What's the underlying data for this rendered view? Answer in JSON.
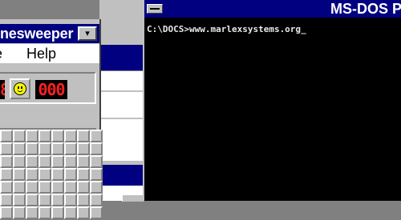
{
  "minesweeper": {
    "title": "nesweeper",
    "title_button_glyph": "▾",
    "menu": {
      "game_label": "e",
      "help_label": "Help"
    },
    "mine_counter": "8",
    "timer": "000",
    "face_icon": "smiley-face-icon",
    "grid": {
      "columns": 8,
      "visible_rows": 7
    }
  },
  "dos": {
    "title": "MS-DOS P",
    "prompt": "C:\\DOCS>www.marlexsystems.org",
    "cursor": "_",
    "system_icon": "system-menu-icon"
  },
  "colors": {
    "title_bar": "#000080",
    "window_face": "#c0c0c0",
    "desktop": "#808080",
    "led_digits": "#ff2020",
    "console_bg": "#000000",
    "console_text": "#e8e8e8"
  }
}
